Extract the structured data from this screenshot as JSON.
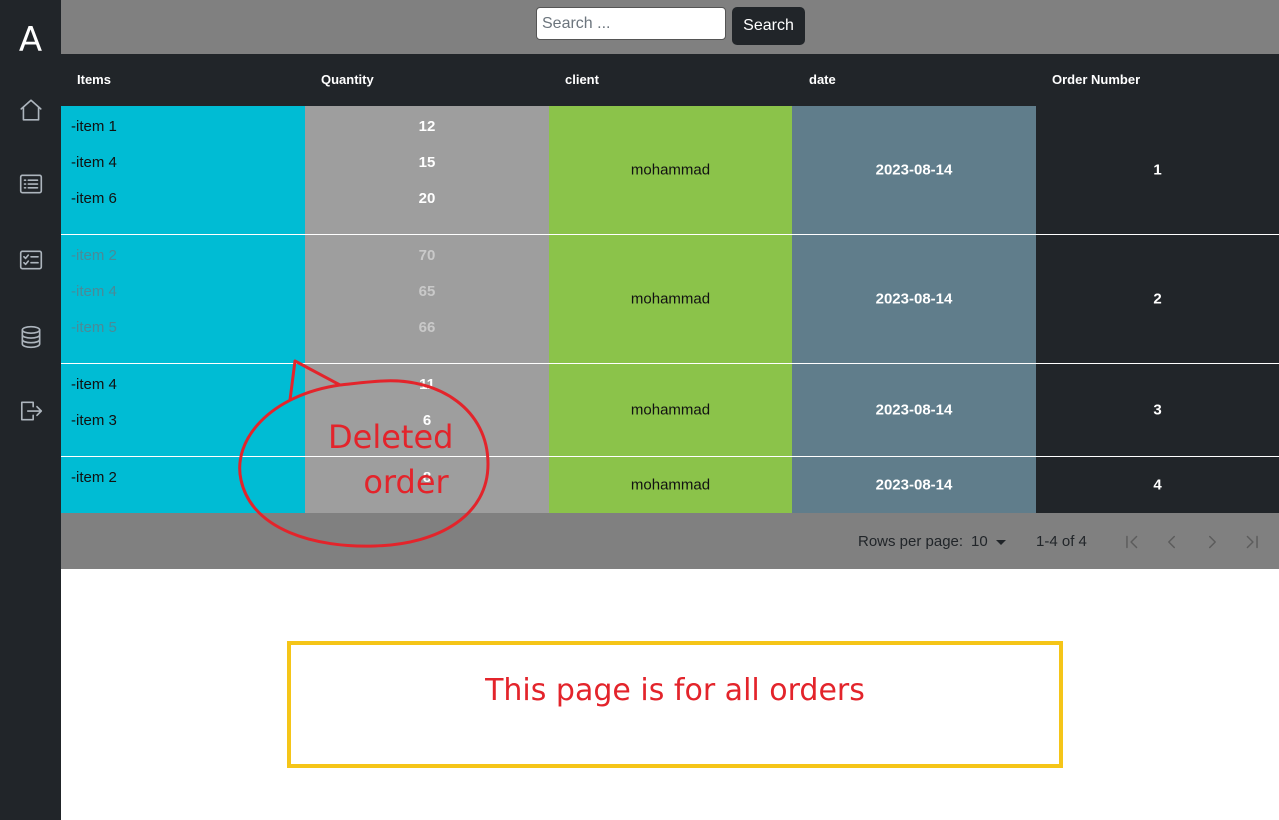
{
  "sidebar": {
    "logo": "A",
    "items": [
      {
        "name": "home",
        "icon": "home-icon"
      },
      {
        "name": "list",
        "icon": "list-icon"
      },
      {
        "name": "checklist",
        "icon": "checklist-card-icon"
      },
      {
        "name": "database",
        "icon": "database-icon"
      },
      {
        "name": "logout",
        "icon": "logout-icon"
      }
    ]
  },
  "search": {
    "placeholder": "Search ...",
    "value": "",
    "button_label": "Search"
  },
  "table": {
    "headers": [
      "Items",
      "Quantity",
      "client",
      "date",
      "Order Number"
    ],
    "rows": [
      {
        "items": [
          "-item 1",
          "-item 4",
          "-item 6"
        ],
        "quantities": [
          "12",
          "15",
          "20"
        ],
        "client": "mohammad",
        "date": "2023-08-14",
        "order_number": "1",
        "deleted": false
      },
      {
        "items": [
          "-item 2",
          "-item 4",
          "-item 5"
        ],
        "quantities": [
          "70",
          "65",
          "66"
        ],
        "client": "mohammad",
        "date": "2023-08-14",
        "order_number": "2",
        "deleted": true
      },
      {
        "items": [
          "-item 4",
          "-item 3"
        ],
        "quantities": [
          "11",
          "6"
        ],
        "client": "mohammad",
        "date": "2023-08-14",
        "order_number": "3",
        "deleted": false
      },
      {
        "items": [
          "-item 2"
        ],
        "quantities": [
          "8"
        ],
        "client": "mohammad",
        "date": "2023-08-14",
        "order_number": "4",
        "deleted": false
      }
    ]
  },
  "pagination": {
    "rows_per_page_label": "Rows per page:",
    "rows_per_page": "10",
    "range": "1-4 of 4"
  },
  "annotations": {
    "callout_line1": "Deleted",
    "callout_line2": "order",
    "note": "This page is for all orders"
  },
  "colors": {
    "items_col": "#00bcd4",
    "quantity_col": "#9e9e9e",
    "client_col": "#8bc34a",
    "date_col": "#607d8b",
    "order_col": "#212529",
    "annotation_red": "#e3242b",
    "note_border": "#f5c518"
  }
}
